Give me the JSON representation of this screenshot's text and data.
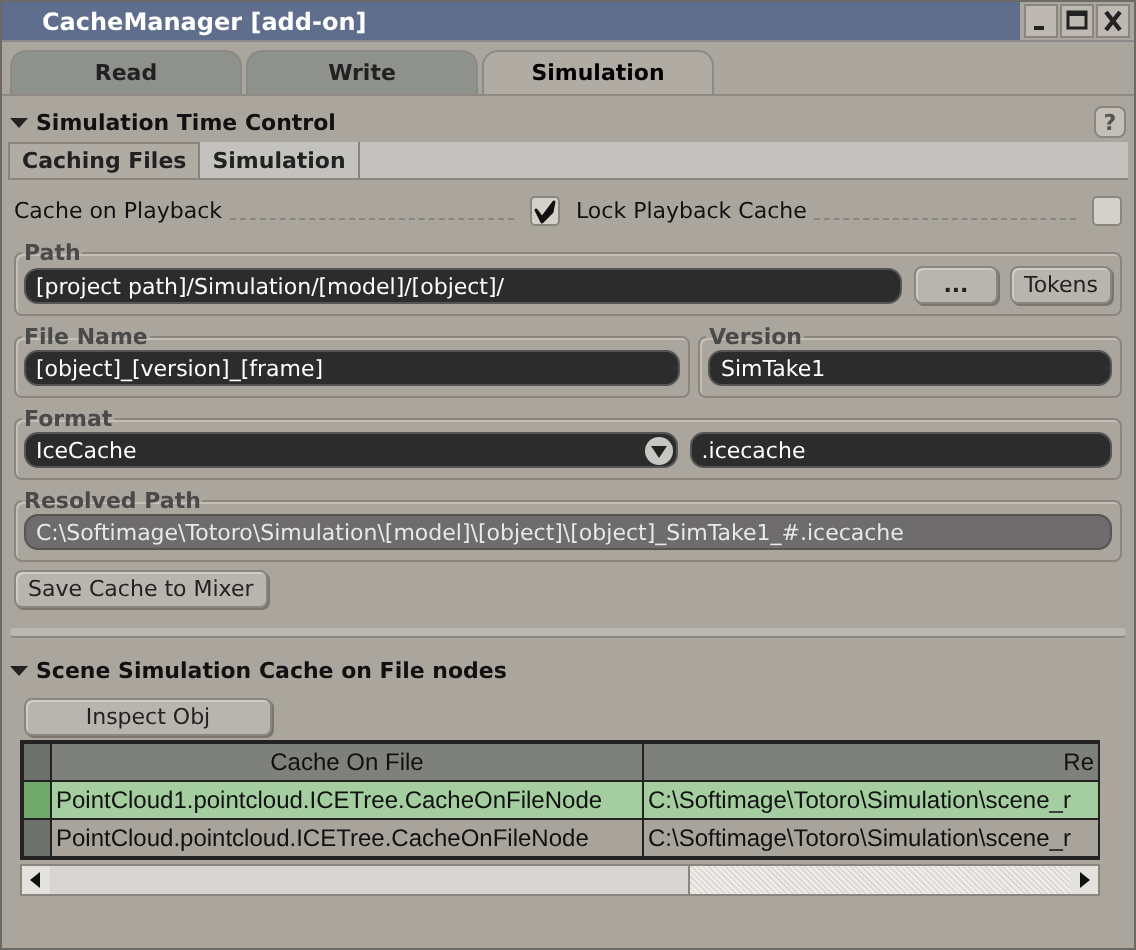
{
  "window": {
    "title": "CacheManager [add-on]"
  },
  "tabs": [
    {
      "label": "Read",
      "selected": false
    },
    {
      "label": "Write",
      "selected": false
    },
    {
      "label": "Simulation",
      "selected": true
    }
  ],
  "time_control": {
    "title": "Simulation Time Control",
    "expanded": true,
    "help": "?",
    "subtabs": [
      {
        "label": "Caching Files",
        "selected": true
      },
      {
        "label": "Simulation",
        "selected": false
      }
    ],
    "options": [
      {
        "label": "Cache on Playback",
        "checked": true
      },
      {
        "label": "Lock Playback Cache",
        "checked": false
      }
    ],
    "path": {
      "label": "Path",
      "value": "[project path]/Simulation/[model]/[object]/",
      "browse_button": "...",
      "tokens_button": "Tokens"
    },
    "file_name": {
      "label": "File Name",
      "value": "[object]_[version]_[frame]"
    },
    "version": {
      "label": "Version",
      "value": "SimTake1"
    },
    "format": {
      "label": "Format",
      "value": "IceCache",
      "extension": ".icecache"
    },
    "resolved_path": {
      "label": "Resolved Path",
      "value": "C:\\Softimage\\Totoro\\Simulation\\[model]\\[object]\\[object]_SimTake1_#.icecache"
    },
    "save_button": "Save Cache to Mixer"
  },
  "scene_cache": {
    "title": "Scene Simulation Cache on File nodes",
    "expanded": true,
    "inspect_button": "Inspect Obj",
    "table": {
      "columns": [
        "Cache On File",
        "Re"
      ],
      "rows": [
        {
          "cells": [
            "PointCloud1.pointcloud.ICETree.CacheOnFileNode",
            "C:\\Softimage\\Totoro\\Simulation\\scene_r"
          ],
          "selected": true
        },
        {
          "cells": [
            "PointCloud.pointcloud.ICETree.CacheOnFileNode",
            "C:\\Softimage\\Totoro\\Simulation\\scene_r"
          ],
          "selected": false
        }
      ]
    }
  }
}
